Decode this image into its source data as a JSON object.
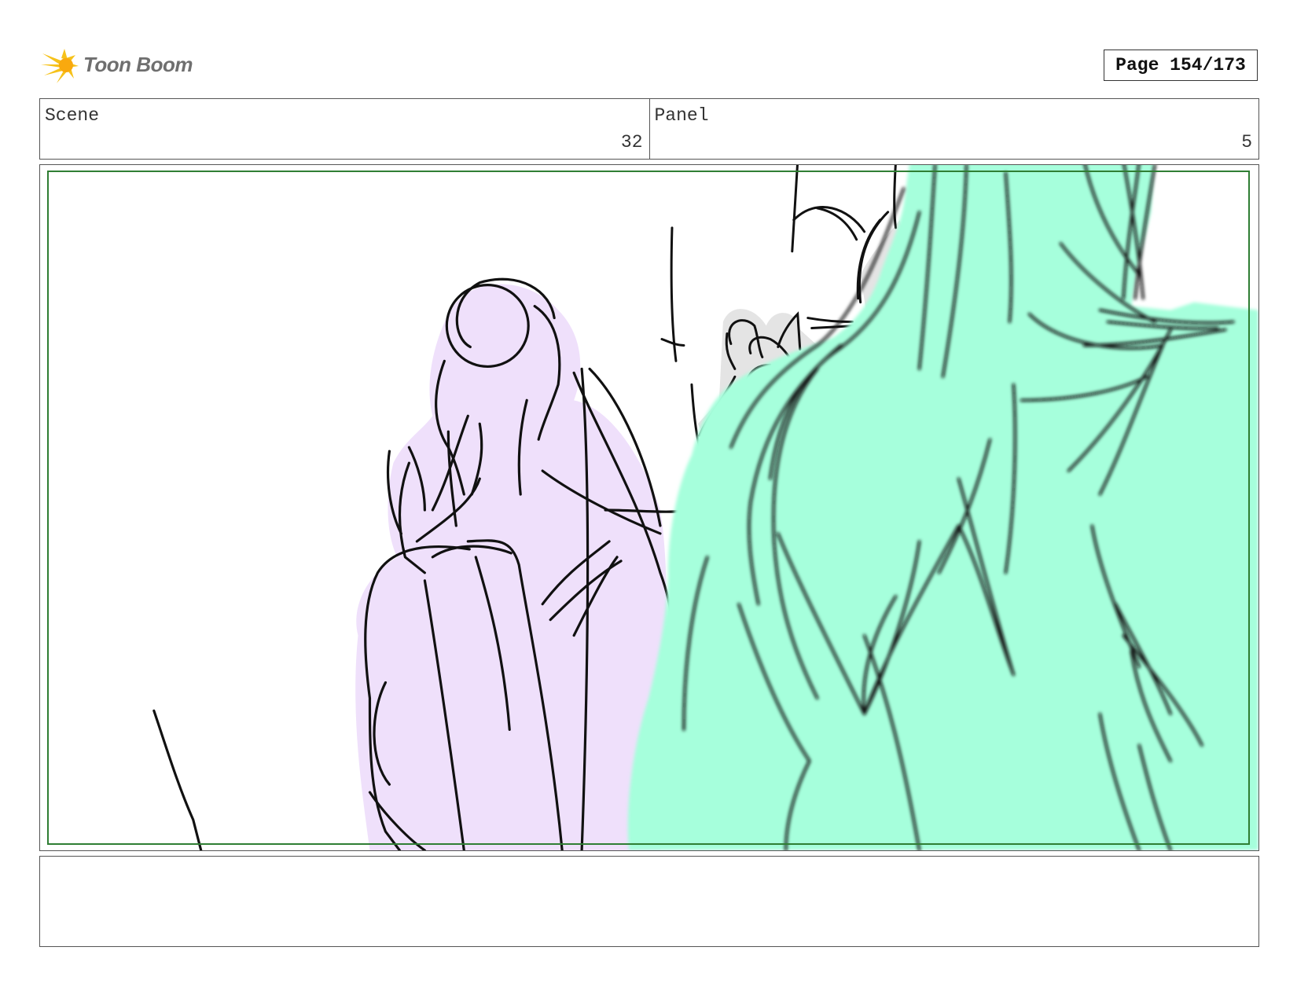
{
  "header": {
    "logo_text": "Toon Boom",
    "page_label": "Page 154/173"
  },
  "info": {
    "scene_label": "Scene",
    "scene_value": "32",
    "panel_label": "Panel",
    "panel_value": "5"
  },
  "drawing": {
    "left_character_fill": "#efe0fb",
    "right_character_fill": "#a6ffdc",
    "background_figure_fill": "#e4e4e4",
    "safe_frame_color": "#2e7d32",
    "line_color": "#111111"
  },
  "notes": {
    "text": ""
  }
}
